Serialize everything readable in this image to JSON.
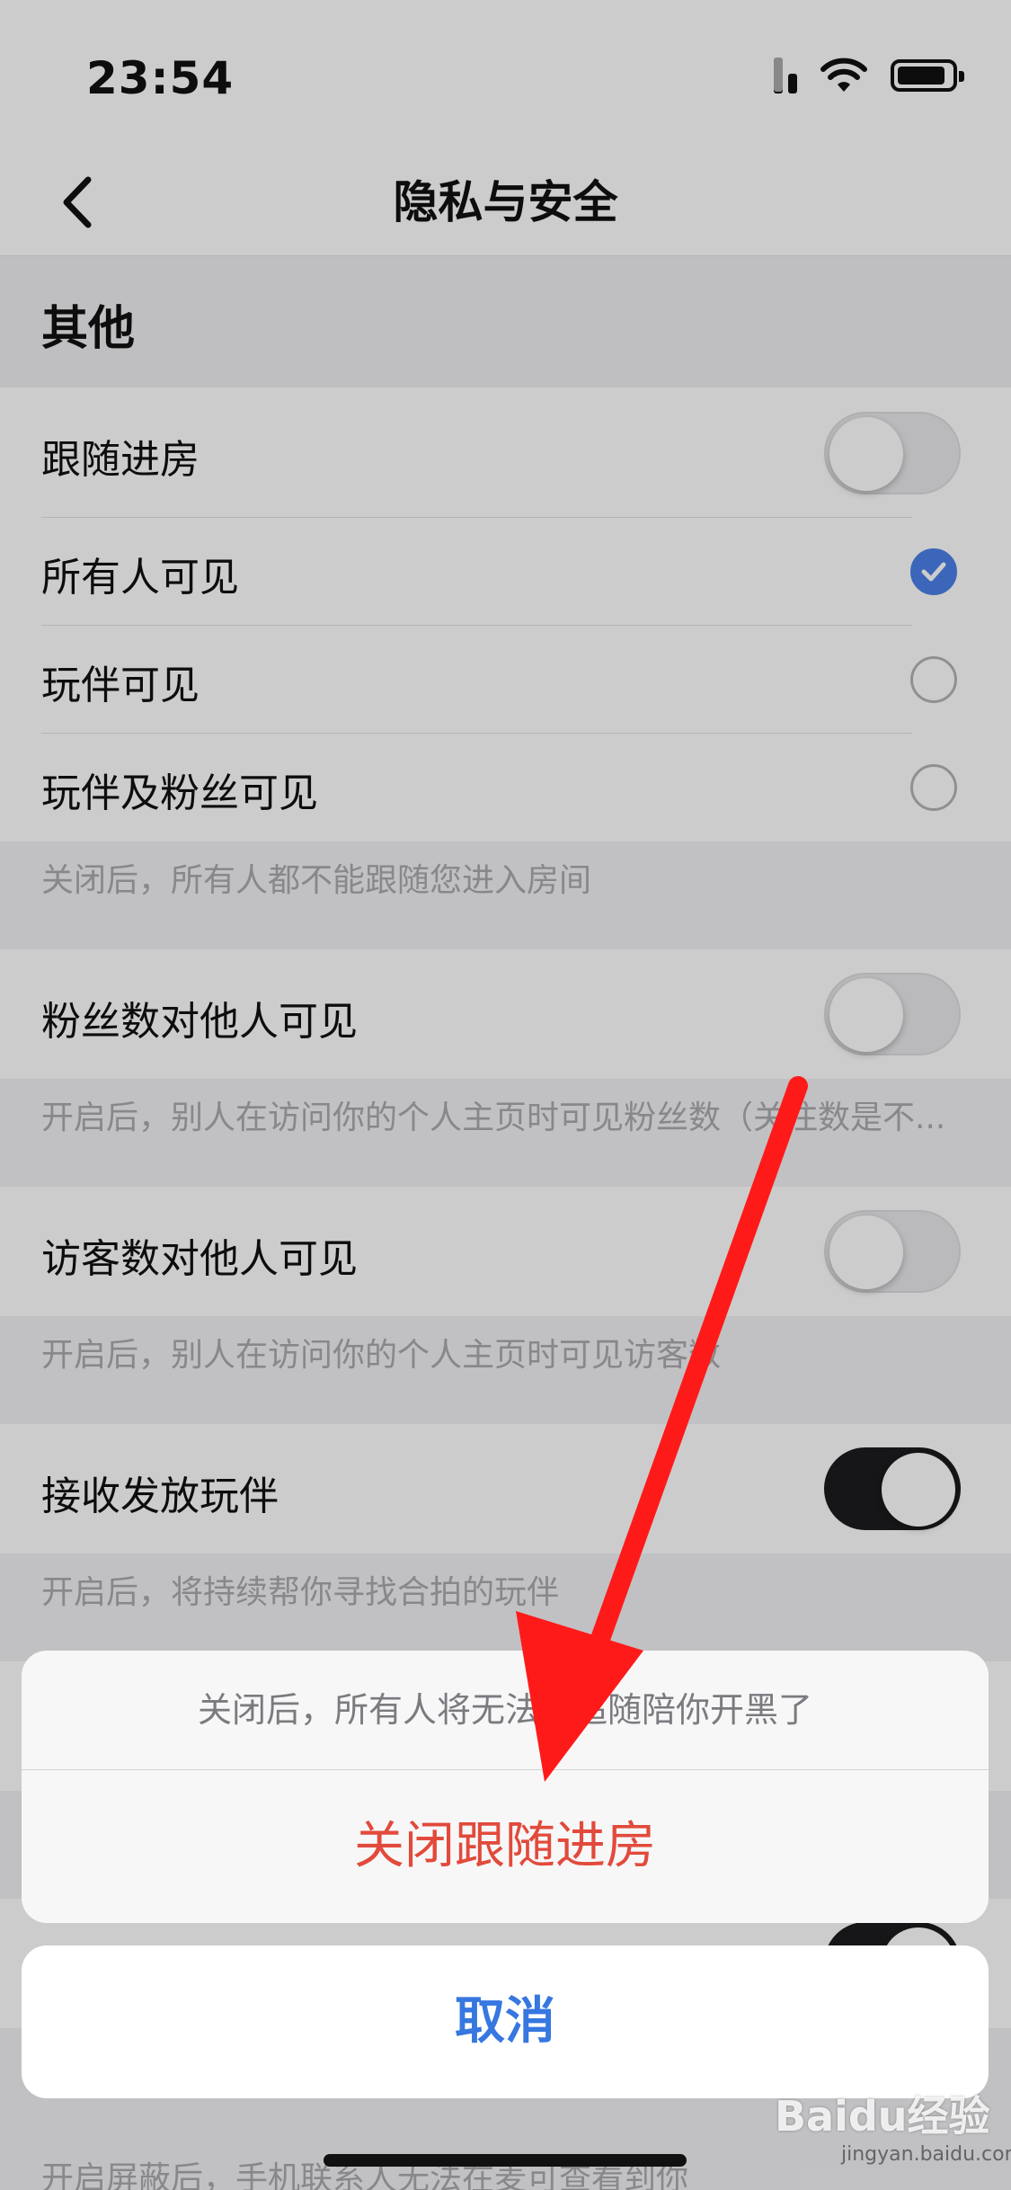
{
  "status_bar": {
    "time": "23:54"
  },
  "nav": {
    "title": "隐私与安全"
  },
  "section": {
    "title": "其他"
  },
  "follow_room": {
    "label": "跟随进房",
    "toggle_on": false,
    "options": [
      {
        "label": "所有人可见",
        "selected": true
      },
      {
        "label": "玩伴可见",
        "selected": false
      },
      {
        "label": "玩伴及粉丝可见",
        "selected": false
      }
    ],
    "note": "关闭后，所有人都不能跟随您进入房间"
  },
  "fans_visible": {
    "label": "粉丝数对他人可见",
    "toggle_on": false,
    "note": "开启后，别人在访问你的个人主页时可见粉丝数（关注数是不..."
  },
  "visitors_visible": {
    "label": "访客数对他人可见",
    "toggle_on": false,
    "note": "开启后，别人在访问你的个人主页时可见访客数"
  },
  "receive_partner": {
    "label": "接收发放玩伴",
    "toggle_on": true,
    "note": "开启后，将持续帮你寻找合拍的玩伴"
  },
  "contacts_block": {
    "note": "开启屏蔽后，手机联系人无法在麦可查看到你"
  },
  "action_sheet": {
    "message": "关闭后，所有人将无法再追随陪你开黑了",
    "destructive_label": "关闭跟随进房",
    "cancel_label": "取消"
  },
  "watermark": {
    "brand": "Baidu经验",
    "url": "jingyan.baidu.com"
  },
  "colors": {
    "accent_blue": "#3677e0",
    "destructive_red": "#e24a3b",
    "arrow_red": "#ff1a1a"
  }
}
